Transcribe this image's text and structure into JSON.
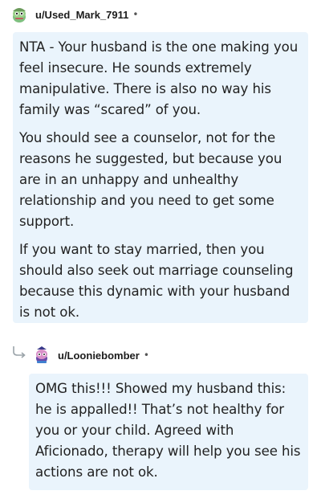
{
  "comments": [
    {
      "username": "u/Used_Mark_7911",
      "separator": "•",
      "paragraphs": [
        "NTA - Your husband is the one making you feel insecure. He sounds extremely manipulative. There is also no way his family was “scared” of you.",
        "You should see a counselor, not for the reasons he suggested, but because you are in an unhappy and unhealthy relationship and you need to get some support.",
        "If you want to stay married, then you should also seek out marriage counseling because this dynamic with your husband is not ok."
      ]
    },
    {
      "username": "u/Looniebomber",
      "separator": "•",
      "paragraphs": [
        "OMG this!!! Showed my husband this: he is appalled!! That’s not healthy for you or your child. Agreed with Aficionado, therapy will help you see his actions are not ok."
      ]
    }
  ],
  "colors": {
    "bubble": "#eaf4fc",
    "text": "#222222"
  }
}
